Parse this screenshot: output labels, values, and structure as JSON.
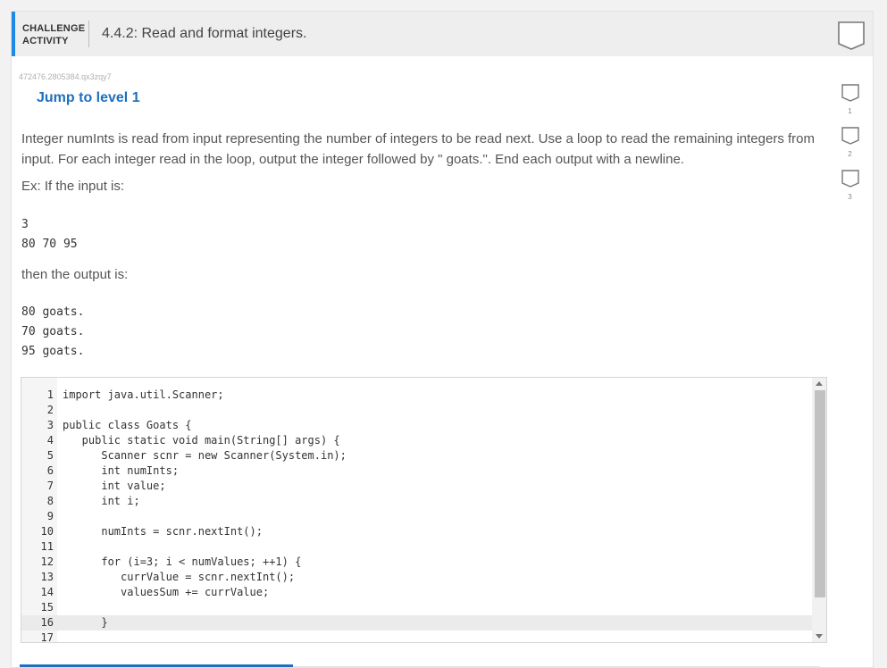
{
  "header": {
    "challenge_line1": "CHALLENGE",
    "challenge_line2": "ACTIVITY",
    "title": "4.4.2: Read and format integers.",
    "accent_color": "#1e88e5"
  },
  "seed": "472476.2805384.qx3zqy7",
  "jump_link": "Jump to level 1",
  "levels": [
    "1",
    "2",
    "3"
  ],
  "description": "Integer numInts is read from input representing the number of integers to be read next. Use a loop to read the remaining integers from input. For each integer read in the loop, output the integer followed by \" goats.\". End each output with a newline.",
  "example_intro": "Ex: If the input is:",
  "example_input": [
    "3",
    "80 70 95"
  ],
  "then_text": "then the output is:",
  "example_output": [
    "80 goats.",
    "70 goats.",
    "95 goats."
  ],
  "editor": {
    "lines": [
      "import java.util.Scanner;",
      "",
      "public class Goats {",
      "   public static void main(String[] args) {",
      "      Scanner scnr = new Scanner(System.in);",
      "      int numInts;",
      "      int value;",
      "      int i;",
      "",
      "      numInts = scnr.nextInt();",
      "",
      "      for (i=3; i < numValues; ++1) {",
      "         currValue = scnr.nextInt();",
      "         valuesSum += currValue;",
      "",
      "      }",
      ""
    ],
    "line_numbers": [
      "1",
      "2",
      "3",
      "4",
      "5",
      "6",
      "7",
      "8",
      "9",
      "10",
      "11",
      "12",
      "13",
      "14",
      "15",
      "16",
      "17"
    ]
  }
}
